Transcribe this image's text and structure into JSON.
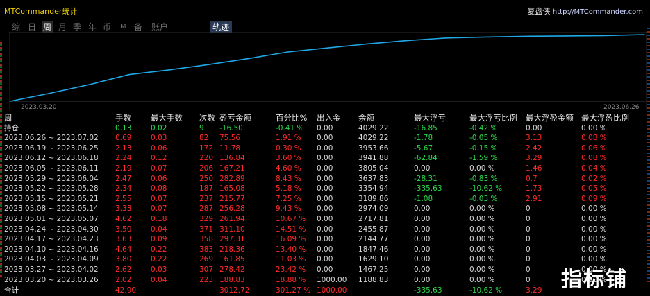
{
  "app": {
    "title": "MTCommander统计",
    "brand_name": "复盘侠",
    "brand_url": "http://MTCommander.com"
  },
  "tabs": [
    {
      "label": "综"
    },
    {
      "label": "日"
    },
    {
      "label": "周",
      "active": true
    },
    {
      "label": "月"
    },
    {
      "label": "季"
    },
    {
      "label": "年"
    },
    {
      "label": "币"
    },
    {
      "label": "M"
    },
    {
      "label": "备"
    },
    {
      "label": "账户"
    },
    {
      "label": "轨迹",
      "highlight": true
    }
  ],
  "chart_data": {
    "type": "line",
    "x_start": "2023.03.20",
    "x_end": "2023.06.26",
    "series": [
      {
        "values": [
          0,
          12,
          25,
          40,
          47,
          55,
          64,
          74,
          80,
          86,
          91,
          95,
          96.5,
          97.5,
          98,
          98.5,
          100
        ]
      }
    ],
    "color": "#20a8e8",
    "ylim": [
      0,
      100
    ]
  },
  "columns": [
    "周",
    "手数",
    "最大手数",
    "次数",
    "盈亏金额",
    "百分比%",
    "出入金",
    "余额",
    "最大浮亏",
    "最大浮亏比例",
    "最大浮盈金额",
    "最大浮盈比例"
  ],
  "holding": {
    "label": "持仓",
    "lots": "0.13",
    "max_lots": "0.02",
    "count": "9",
    "pnl": "-16.50",
    "pct": "-0.41 %",
    "io": "0.00",
    "balance": "4029.22",
    "max_dd": "-16.85",
    "max_dd_pct": "-0.42 %",
    "max_fp": "0.00",
    "max_fp_pct": "0.00 %"
  },
  "rows": [
    {
      "week": "2023.06.26 ~ 2023.07.02",
      "lots": "0.69",
      "max_lots": "0.03",
      "count": "82",
      "pnl": "75.56",
      "pct": "1.91 %",
      "io": "0.00",
      "balance": "4029.22",
      "max_dd": "-1.78",
      "max_dd_pct": "-0.05 %",
      "max_fp": "3.13",
      "max_fp_pct": "0.08 %"
    },
    {
      "week": "2023.06.19 ~ 2023.06.25",
      "lots": "2.13",
      "max_lots": "0.06",
      "count": "172",
      "pnl": "11.78",
      "pct": "0.30 %",
      "io": "0.00",
      "balance": "3953.66",
      "max_dd": "-5.67",
      "max_dd_pct": "-0.15 %",
      "max_fp": "2.42",
      "max_fp_pct": "0.06 %"
    },
    {
      "week": "2023.06.12 ~ 2023.06.18",
      "lots": "2.24",
      "max_lots": "0.12",
      "count": "220",
      "pnl": "136.84",
      "pct": "3.60 %",
      "io": "0.00",
      "balance": "3941.88",
      "max_dd": "-62.84",
      "max_dd_pct": "-1.59 %",
      "max_fp": "3.29",
      "max_fp_pct": "0.08 %"
    },
    {
      "week": "2023.06.05 ~ 2023.06.11",
      "lots": "2.19",
      "max_lots": "0.07",
      "count": "206",
      "pnl": "167.21",
      "pct": "4.60 %",
      "io": "0.00",
      "balance": "3805.04",
      "max_dd": "0.00",
      "max_dd_pct": "0.00 %",
      "max_fp": "1.46",
      "max_fp_pct": "0.04 %"
    },
    {
      "week": "2023.05.29 ~ 2023.06.04",
      "lots": "2.47",
      "max_lots": "0.06",
      "count": "250",
      "pnl": "282.89",
      "pct": "8.43 %",
      "io": "0.00",
      "balance": "3637.83",
      "max_dd": "-28.31",
      "max_dd_pct": "-0.83 %",
      "max_fp": "0.7",
      "max_fp_pct": "0.02 %"
    },
    {
      "week": "2023.05.22 ~ 2023.05.28",
      "lots": "2.34",
      "max_lots": "0.08",
      "count": "187",
      "pnl": "165.08",
      "pct": "5.18 %",
      "io": "0.00",
      "balance": "3354.94",
      "max_dd": "-335.63",
      "max_dd_pct": "-10.62 %",
      "max_fp": "1.73",
      "max_fp_pct": "0.05 %"
    },
    {
      "week": "2023.05.15 ~ 2023.05.21",
      "lots": "2.55",
      "max_lots": "0.07",
      "count": "237",
      "pnl": "215.77",
      "pct": "7.25 %",
      "io": "0.00",
      "balance": "3189.86",
      "max_dd": "-1.08",
      "max_dd_pct": "-0.03 %",
      "max_fp": "2.91",
      "max_fp_pct": "0.09 %"
    },
    {
      "week": "2023.05.08 ~ 2023.05.14",
      "lots": "3.33",
      "max_lots": "0.07",
      "count": "287",
      "pnl": "256.28",
      "pct": "9.43 %",
      "io": "0.00",
      "balance": "2974.09",
      "max_dd": "0.00",
      "max_dd_pct": "0.00 %",
      "max_fp": "0",
      "max_fp_pct": "0.00 %"
    },
    {
      "week": "2023.05.01 ~ 2023.05.07",
      "lots": "4.62",
      "max_lots": "0.18",
      "count": "329",
      "pnl": "261.94",
      "pct": "10.67 %",
      "io": "0.00",
      "balance": "2717.81",
      "max_dd": "0.00",
      "max_dd_pct": "0.00 %",
      "max_fp": "0",
      "max_fp_pct": "0.00 %"
    },
    {
      "week": "2023.04.24 ~ 2023.04.30",
      "lots": "3.50",
      "max_lots": "0.04",
      "count": "371",
      "pnl": "311.10",
      "pct": "14.51 %",
      "io": "0.00",
      "balance": "2455.87",
      "max_dd": "0.00",
      "max_dd_pct": "0.00 %",
      "max_fp": "0",
      "max_fp_pct": "0.00 %"
    },
    {
      "week": "2023.04.17 ~ 2023.04.23",
      "lots": "3.63",
      "max_lots": "0.09",
      "count": "358",
      "pnl": "297.31",
      "pct": "16.09 %",
      "io": "0.00",
      "balance": "2144.77",
      "max_dd": "0.00",
      "max_dd_pct": "0.00 %",
      "max_fp": "0",
      "max_fp_pct": "0.00 %"
    },
    {
      "week": "2023.04.10 ~ 2023.04.16",
      "lots": "4.64",
      "max_lots": "0.22",
      "count": "383",
      "pnl": "218.36",
      "pct": "13.40 %",
      "io": "0.00",
      "balance": "1847.46",
      "max_dd": "0.00",
      "max_dd_pct": "0.00 %",
      "max_fp": "0",
      "max_fp_pct": "0.00 %"
    },
    {
      "week": "2023.04.03 ~ 2023.04.09",
      "lots": "3.80",
      "max_lots": "0.22",
      "count": "269",
      "pnl": "161.85",
      "pct": "11.03 %",
      "io": "0.00",
      "balance": "1629.10",
      "max_dd": "0.00",
      "max_dd_pct": "0.00 %",
      "max_fp": "0",
      "max_fp_pct": "0.00 %"
    },
    {
      "week": "2023.03.27 ~ 2023.04.02",
      "lots": "2.62",
      "max_lots": "0.03",
      "count": "307",
      "pnl": "278.42",
      "pct": "23.42 %",
      "io": "0.00",
      "balance": "1467.25",
      "max_dd": "0.00",
      "max_dd_pct": "0.00 %",
      "max_fp": "0",
      "max_fp_pct": "0.00 %"
    },
    {
      "week": "2023.03.20 ~ 2023.03.26",
      "lots": "2.02",
      "max_lots": "0.04",
      "count": "223",
      "pnl": "188.83",
      "pct": "18.88 %",
      "io": "1000.00",
      "balance": "1188.83",
      "max_dd": "0.00",
      "max_dd_pct": "0.00 %",
      "max_fp": "0",
      "max_fp_pct": "0.00 %"
    }
  ],
  "total": {
    "label": "合计",
    "lots": "42.90",
    "pnl": "3012.72",
    "pct": "301.27 %",
    "io": "1000.00",
    "max_dd": "-335.63",
    "max_dd_pct": "-10.62 %",
    "max_fp": "3.29"
  },
  "watermark": "指标铺",
  "colors": {
    "positive": "#ff2a2a",
    "negative": "#2bd94a",
    "neutral": "#d7d7d7",
    "title": "#f0d200"
  }
}
